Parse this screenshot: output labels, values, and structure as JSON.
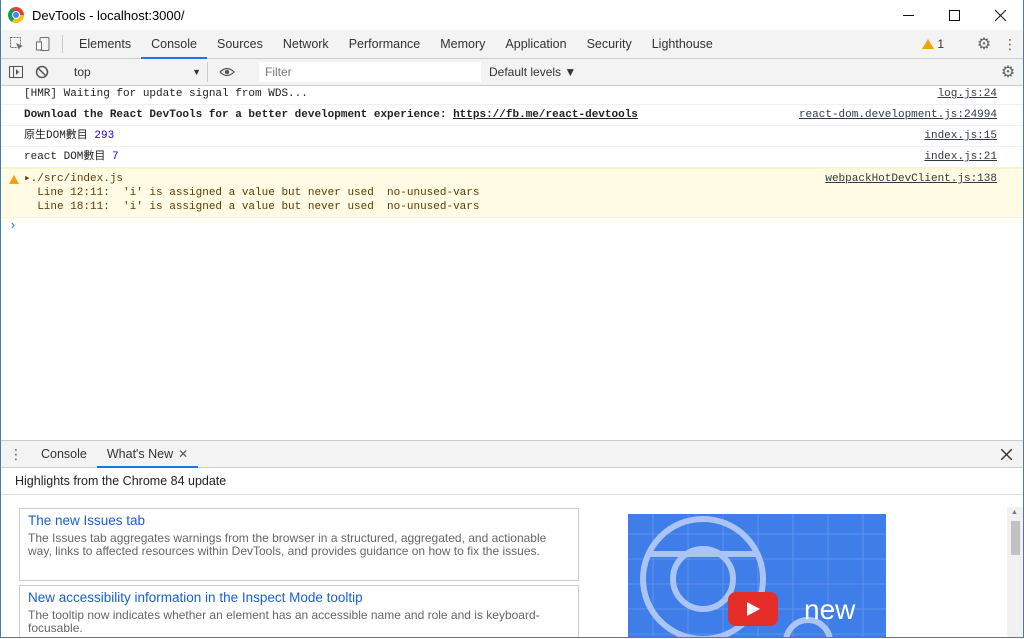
{
  "window": {
    "title": "DevTools - localhost:3000/"
  },
  "panels": [
    "Elements",
    "Console",
    "Sources",
    "Network",
    "Performance",
    "Memory",
    "Application",
    "Security",
    "Lighthouse"
  ],
  "active_panel": "Console",
  "warnings": {
    "count": "1"
  },
  "console_toolbar": {
    "context": "top",
    "filter_placeholder": "Filter",
    "levels": "Default levels ▼"
  },
  "messages": [
    {
      "text": "[HMR] Waiting for update signal from WDS...",
      "source": "log.js:24"
    },
    {
      "text_bold": "Download the React DevTools for a better development experience: ",
      "link": "https://fb.me/react-devtools",
      "source": "react-dom.development.js:24994"
    },
    {
      "text": "原生DOM數目",
      "value": "293",
      "source": "index.js:15"
    },
    {
      "text": "react DOM數目",
      "value": "7",
      "source": "index.js:21"
    }
  ],
  "warning": {
    "title": "▸./src/index.js",
    "lines": [
      "  Line 12:11:  'i' is assigned a value but never used  no-unused-vars",
      "  Line 18:11:  'i' is assigned a value but never used  no-unused-vars"
    ],
    "source": "webpackHotDevClient.js:138"
  },
  "prompt": "›",
  "drawer": {
    "tabs": [
      "Console",
      "What's New"
    ],
    "active_tab": "What's New",
    "highlights": "Highlights from the Chrome 84 update",
    "cards": [
      {
        "title": "The new Issues tab",
        "desc": "The Issues tab aggregates warnings from the browser in a structured, aggregated, and actionable way, links to affected resources within DevTools, and provides guidance on how to fix the issues."
      },
      {
        "title": "New accessibility information in the Inspect Mode tooltip",
        "desc": "The tooltip now indicates whether an element has an accessible name and role and is keyboard-focusable."
      }
    ],
    "video_text": "new"
  },
  "colors": {
    "accent": "#1a73e8",
    "warning_bg": "#fffbe5",
    "link": "#1a5fcf",
    "video_bg": "#3f7de8"
  }
}
